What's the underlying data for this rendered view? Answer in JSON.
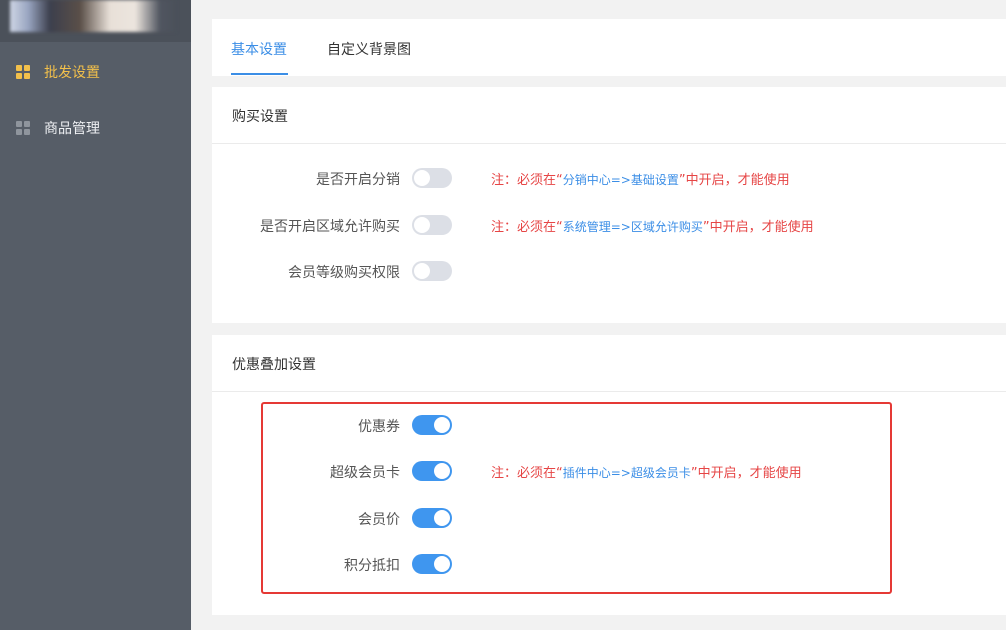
{
  "sidebar": {
    "items": [
      {
        "label": "批发设置",
        "active": true,
        "icon": "grid-icon"
      },
      {
        "label": "商品管理",
        "active": false,
        "icon": "grid-icon"
      }
    ]
  },
  "tabs": [
    {
      "label": "基本设置",
      "active": true
    },
    {
      "label": "自定义背景图",
      "active": false
    }
  ],
  "purchase_settings": {
    "title": "购买设置",
    "rows": [
      {
        "label": "是否开启分销",
        "enabled": false,
        "note_prefix": "注：必须在“",
        "note_link": "分销中心=>基础设置",
        "note_suffix": "”中开启，才能使用"
      },
      {
        "label": "是否开启区域允许购买",
        "enabled": false,
        "note_prefix": "注：必须在“",
        "note_link": "系统管理=>区域允许购买",
        "note_suffix": "”中开启，才能使用"
      },
      {
        "label": "会员等级购买权限",
        "enabled": false
      }
    ]
  },
  "discount_settings": {
    "title": "优惠叠加设置",
    "rows": [
      {
        "label": "优惠券",
        "enabled": true
      },
      {
        "label": "超级会员卡",
        "enabled": true,
        "note_prefix": "注：必须在“",
        "note_link": "插件中心=>超级会员卡",
        "note_suffix": "”中开启，才能使用"
      },
      {
        "label": "会员价",
        "enabled": true
      },
      {
        "label": "积分抵扣",
        "enabled": true
      }
    ]
  },
  "colors": {
    "accent": "#3b8ee6",
    "sidebar_bg": "#565d67",
    "active_nav": "#f2c04b",
    "note_red": "#e64545",
    "highlight_border": "#e53935"
  }
}
